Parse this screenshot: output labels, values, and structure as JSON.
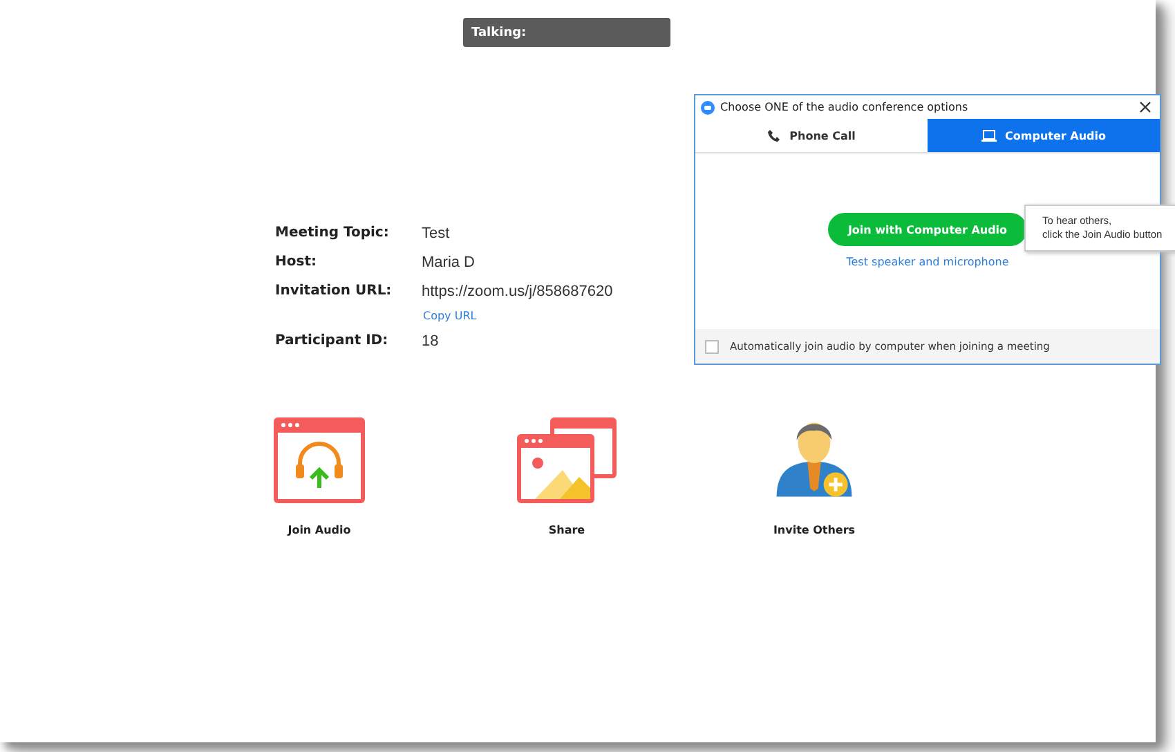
{
  "talking_bar": {
    "label": "Talking:"
  },
  "meeting_info": [
    {
      "label": "Meeting Topic:",
      "value": "Test"
    },
    {
      "label": "Host:",
      "value": "Maria D"
    },
    {
      "label": "Invitation URL:",
      "value": "https://zoom.us/j/858687620",
      "link": "Copy URL"
    },
    {
      "label": "Participant ID:",
      "value": "18"
    }
  ],
  "actions": [
    {
      "kind": "audio",
      "label": "Join Audio"
    },
    {
      "kind": "share",
      "label": "Share"
    },
    {
      "kind": "invite",
      "label": "Invite Others"
    }
  ],
  "dialog": {
    "title": "Choose ONE of the audio conference options",
    "tabs": [
      {
        "kind": "phone",
        "label": "Phone Call",
        "selected": false
      },
      {
        "kind": "computer",
        "label": "Computer Audio",
        "selected": true
      }
    ],
    "join_button": "Join with Computer Audio",
    "test_link": "Test speaker and microphone",
    "tooltip": "To hear others,\nclick the Join Audio button",
    "auto_join": {
      "label": "Automatically join audio by computer when joining a meeting",
      "checked": false
    }
  }
}
